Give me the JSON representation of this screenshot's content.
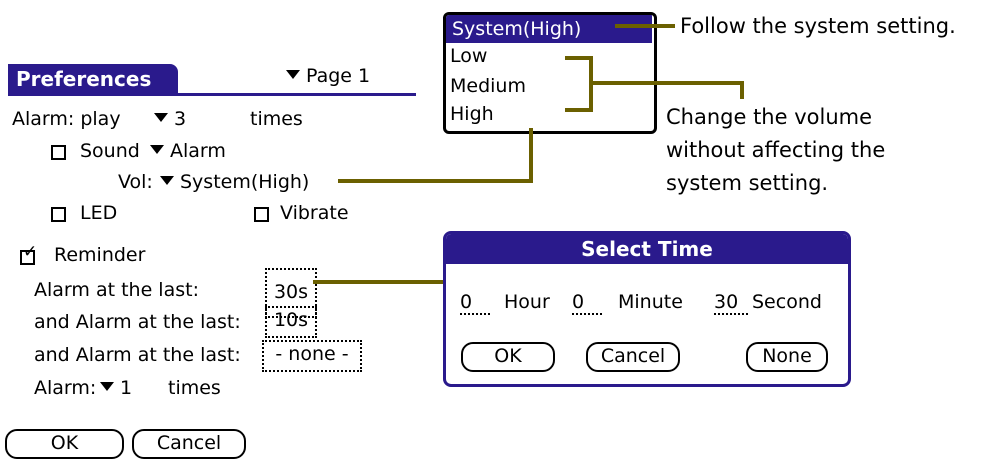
{
  "form": {
    "title": "Preferences",
    "page_label": "Page 1",
    "alarm_play": {
      "prefix": "Alarm: play",
      "count": "3",
      "suffix": "times"
    },
    "sound": {
      "label": "Sound",
      "value": "Alarm",
      "checked": false
    },
    "vol": {
      "label": "Vol:",
      "value": "System(High)"
    },
    "led": {
      "label": "LED",
      "checked": false
    },
    "vibrate": {
      "label": "Vibrate",
      "checked": false
    },
    "reminder": {
      "label": "Reminder",
      "checked": true
    },
    "rows": [
      {
        "label": "Alarm at the last:",
        "value": "30s"
      },
      {
        "label": "and Alarm at the last:",
        "value": "10s"
      },
      {
        "label": "and Alarm at the last:",
        "value": "- none -"
      }
    ],
    "alarm_times": {
      "prefix": "Alarm:",
      "count": "1",
      "suffix": "times"
    },
    "ok": "OK",
    "cancel": "Cancel"
  },
  "volume_popup": {
    "options": [
      "System(High)",
      "Low",
      "Medium",
      "High"
    ],
    "selected": "System(High)"
  },
  "annotations": {
    "follow": "Follow the system setting.",
    "change": [
      "Change the volume",
      "without affecting the",
      "system setting."
    ]
  },
  "select_time": {
    "title": "Select Time",
    "hour_value": "0",
    "hour_label": "Hour",
    "minute_value": "0",
    "minute_label": "Minute",
    "second_value": "30",
    "second_label": "Second",
    "ok": "OK",
    "cancel": "Cancel",
    "none": "None"
  },
  "colors": {
    "accent": "#2a1a8c",
    "callout": "#6b6000"
  }
}
